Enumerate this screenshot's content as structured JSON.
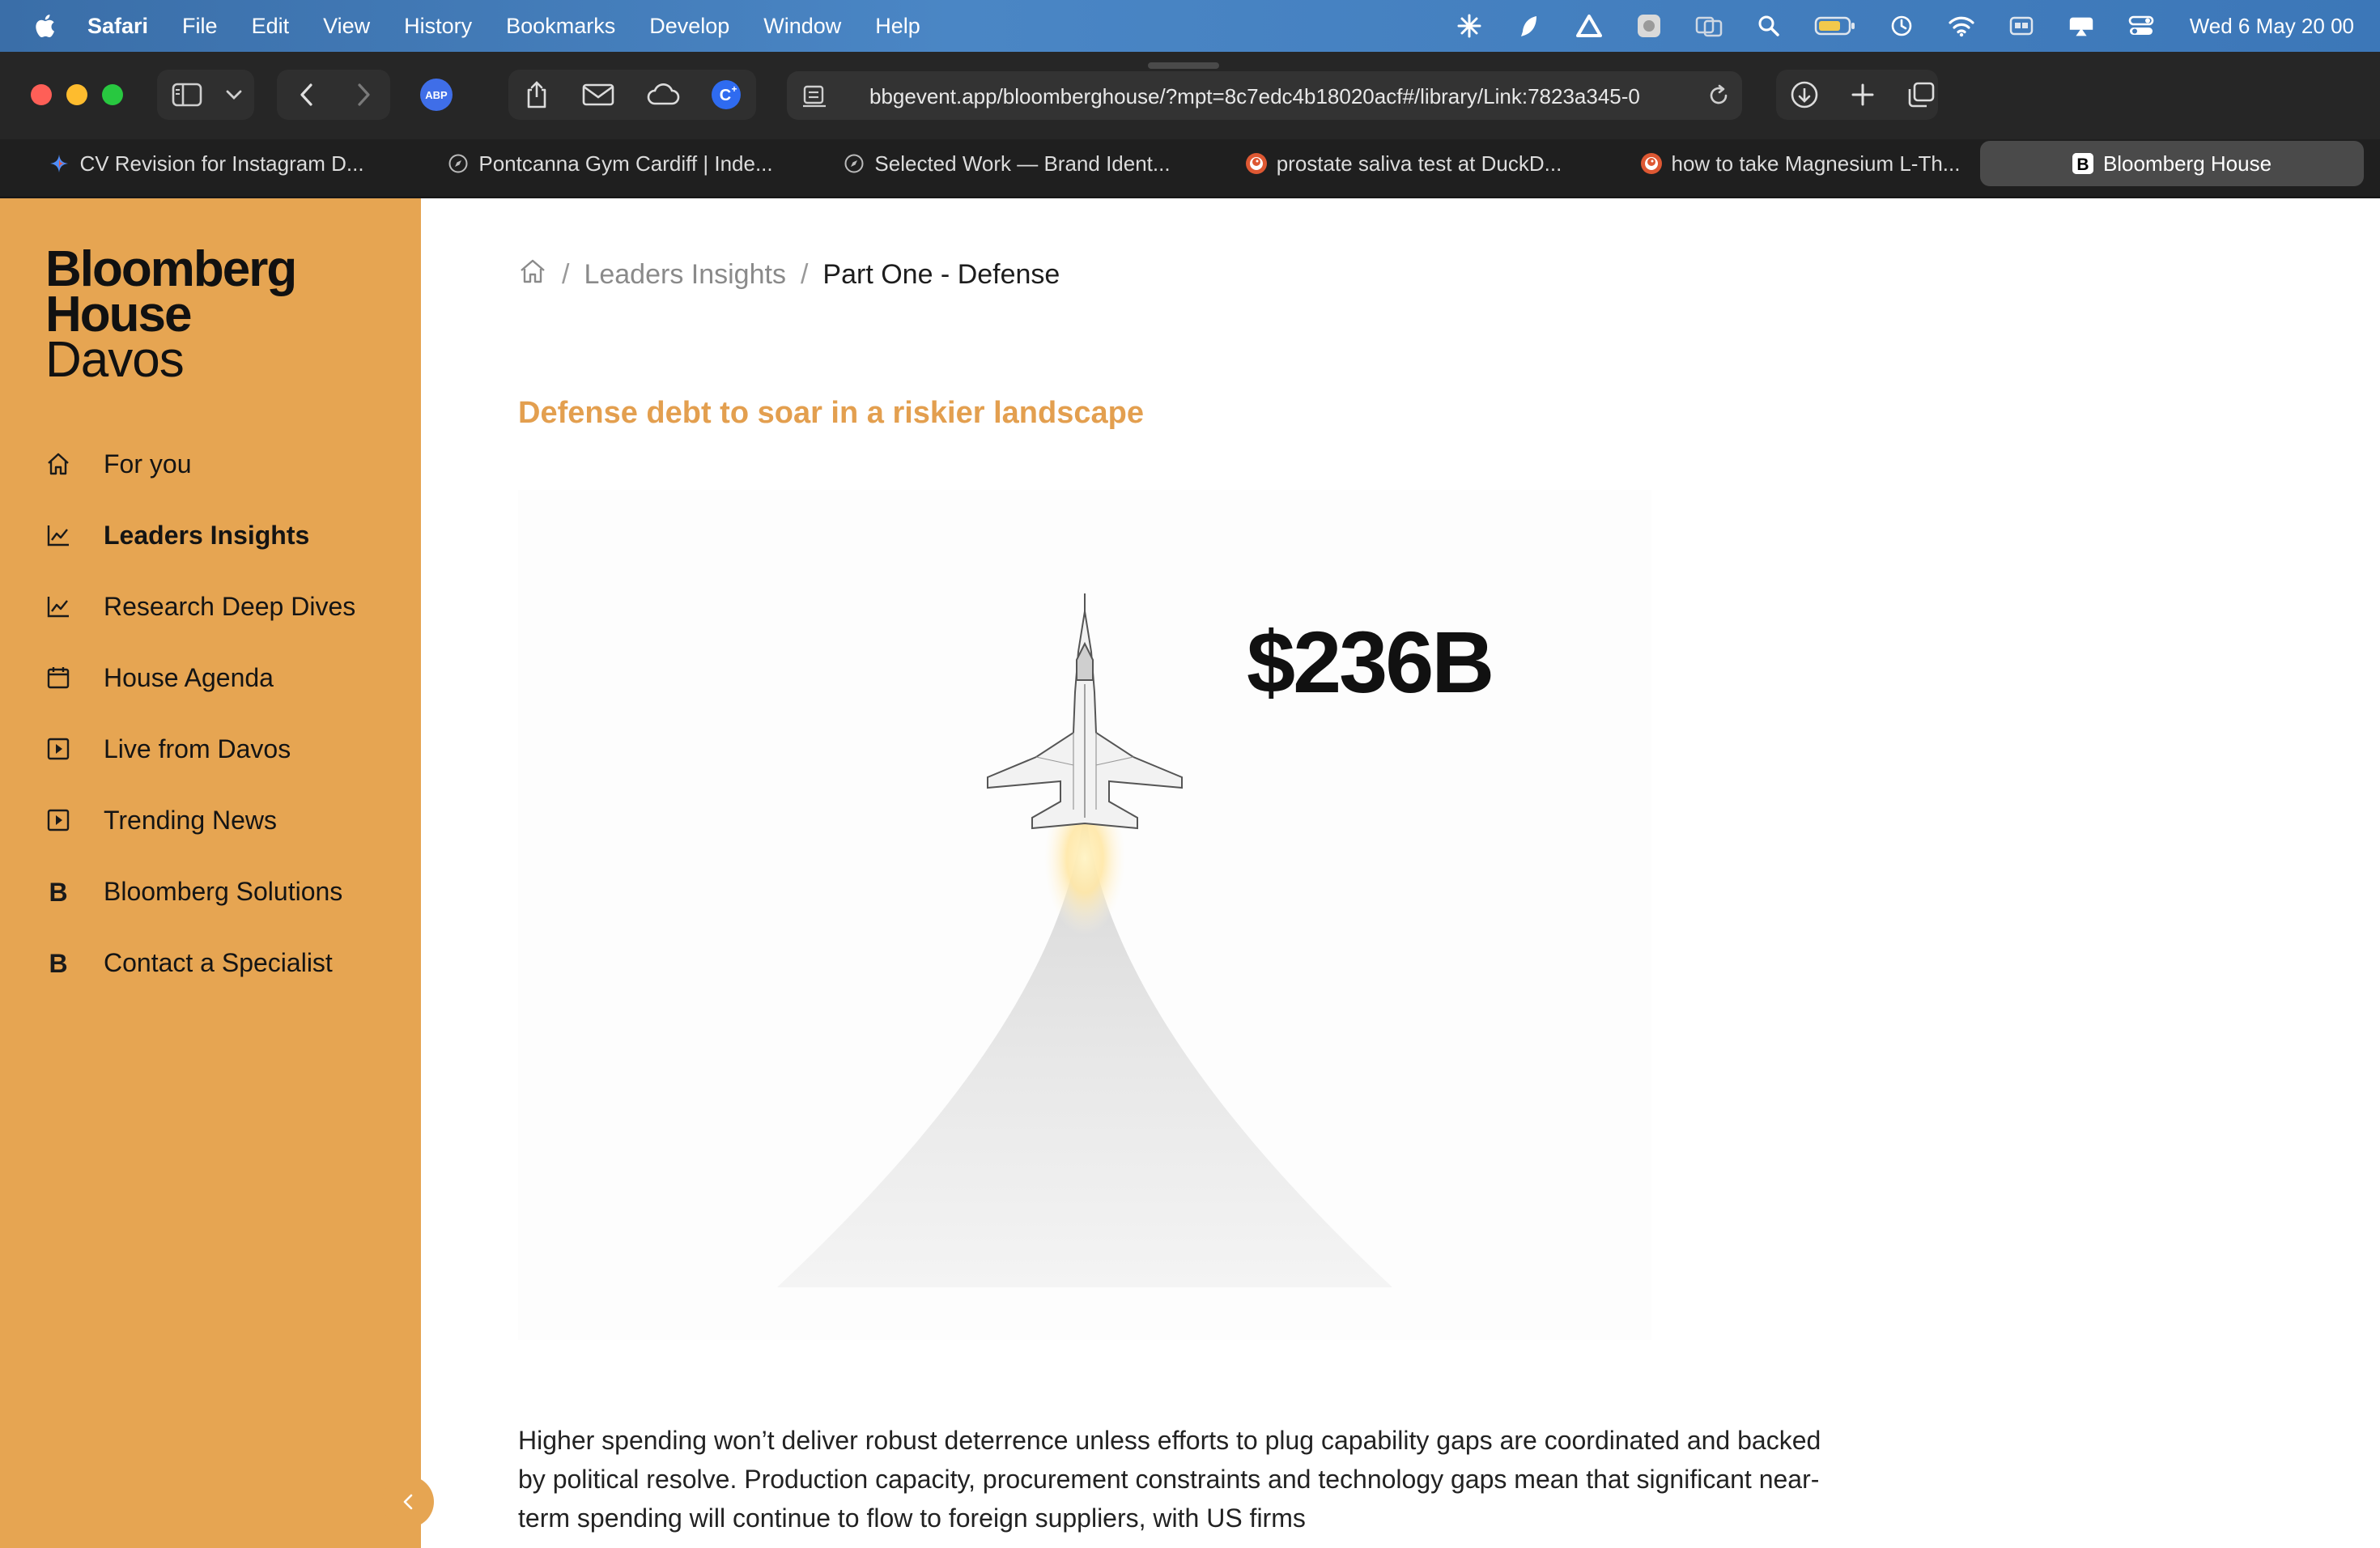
{
  "menubar": {
    "app_name": "Safari",
    "menus": [
      "File",
      "Edit",
      "View",
      "History",
      "Bookmarks",
      "Develop",
      "Window",
      "Help"
    ],
    "clock": "Wed 6 May  20 00",
    "battery_color": "#f2c94c"
  },
  "browser": {
    "url": "bbgevent.app/bloomberghouse/?mpt=8c7edc4b18020acf#/library/Link:7823a345-0",
    "extension_abp_label": "ABP",
    "tabs": [
      {
        "label": "CV Revision for Instagram D...",
        "icon": "sparkle-icon"
      },
      {
        "label": "Pontcanna Gym Cardiff | Inde...",
        "icon": "compass-icon"
      },
      {
        "label": "Selected Work — Brand Ident...",
        "icon": "compass-icon"
      },
      {
        "label": "prostate saliva test at DuckD...",
        "icon": "duckduckgo-icon"
      },
      {
        "label": "how to take Magnesium L-Th...",
        "icon": "duckduckgo-icon"
      },
      {
        "label": "Bloomberg House",
        "icon": "bloomberg-b-icon",
        "active": true
      }
    ]
  },
  "sidebar": {
    "brand": {
      "line1": "Bloomberg",
      "line2": "House",
      "line3": "Davos"
    },
    "accent_color": "#e6a552",
    "items": [
      {
        "label": "For you",
        "icon": "home-icon"
      },
      {
        "label": "Leaders Insights",
        "icon": "chart-line-icon",
        "current": true
      },
      {
        "label": "Research Deep Dives",
        "icon": "chart-line-icon"
      },
      {
        "label": "House Agenda",
        "icon": "calendar-icon"
      },
      {
        "label": "Live from Davos",
        "icon": "play-square-icon"
      },
      {
        "label": "Trending News",
        "icon": "play-square-icon"
      },
      {
        "label": "Bloomberg Solutions",
        "icon": "bloomberg-b-icon"
      },
      {
        "label": "Contact a Specialist",
        "icon": "bloomberg-b-icon"
      }
    ]
  },
  "breadcrumb": {
    "separator": "/",
    "items": [
      "Leaders Insights",
      "Part One - Defense"
    ]
  },
  "article": {
    "headline": "Defense debt to soar in a riskier landscape",
    "headline_color": "#e39f4f",
    "figure_amount": "$236B",
    "body": "Higher spending won’t deliver robust deterrence unless efforts to plug capability gaps are coordinated and backed by political resolve. Production capacity, procurement constraints and technology gaps mean that significant near-term spending will continue to flow to foreign suppliers, with US firms"
  }
}
